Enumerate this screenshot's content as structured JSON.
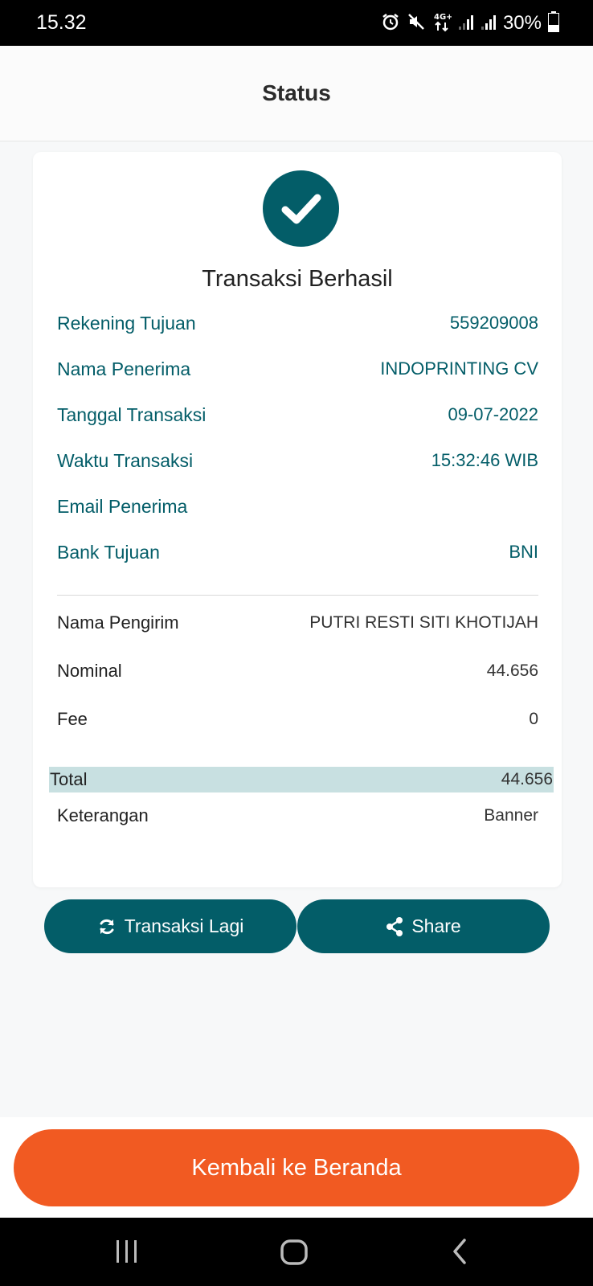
{
  "status_bar": {
    "time": "15.32",
    "network": "4G+",
    "battery": "30%",
    "icons": [
      "alarm-icon",
      "mute-icon",
      "network-4g-icon",
      "signal-icon",
      "signal-icon",
      "battery-icon"
    ]
  },
  "header": {
    "title": "Status"
  },
  "result": {
    "icon": "check-icon",
    "title": "Transaksi Berhasil"
  },
  "details": [
    {
      "label": "Rekening Tujuan",
      "value": "559209008"
    },
    {
      "label": "Nama Penerima",
      "value": "INDOPRINTING CV"
    },
    {
      "label": "Tanggal Transaksi",
      "value": "09-07-2022"
    },
    {
      "label": "Waktu Transaksi",
      "value": "15:32:46 WIB"
    },
    {
      "label": "Email Penerima",
      "value": ""
    },
    {
      "label": "Bank Tujuan",
      "value": "BNI"
    }
  ],
  "summary": [
    {
      "label": "Nama Pengirim",
      "value": "PUTRI RESTI SITI KHOTIJAH"
    },
    {
      "label": "Nominal",
      "value": "44.656"
    },
    {
      "label": "Fee",
      "value": "0"
    }
  ],
  "total": {
    "label": "Total",
    "value": "44.656"
  },
  "note": {
    "label": "Keterangan",
    "value": "Banner"
  },
  "actions": {
    "again_label": "Transaksi Lagi",
    "again_icon": "refresh-icon",
    "share_label": "Share",
    "share_icon": "share-icon"
  },
  "home_button": {
    "label": "Kembali ke Beranda"
  },
  "nav_bar": {
    "icons": [
      "recent-apps-icon",
      "home-icon",
      "back-icon"
    ]
  },
  "colors": {
    "primary": "#035d68",
    "accent": "#f15a22",
    "total_highlight": "#c8e0e1"
  }
}
